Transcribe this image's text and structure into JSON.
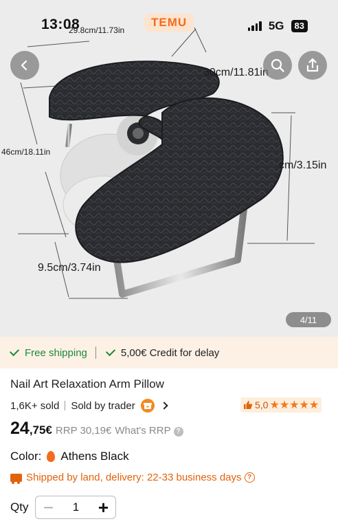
{
  "status_bar": {
    "time": "13:08",
    "network": "5G",
    "battery": "83"
  },
  "brand_badge": "TEMU",
  "gallery": {
    "counter": "4/11",
    "dimensions": {
      "top_width": "29.8cm/11.73in",
      "depth": "30cm/11.81in",
      "height": "46cm/18.11in",
      "thickness": "cm/3.15in",
      "base": "9.5cm/3.74in"
    }
  },
  "shipping_strip": {
    "free_shipping": "Free shipping",
    "credit": "5,00€ Credit for delay"
  },
  "product": {
    "title": "Nail Art Relaxation Arm Pillow",
    "sold": "1,6K+ sold",
    "seller": "Sold by trader",
    "rating": "5,0",
    "stars": "★★★★★",
    "price_main": "24",
    "price_cents": ",75€",
    "rrp": "RRP 30,19€",
    "whats_rrp": "What's RRP",
    "color_label": "Color:",
    "color_value": "Athens Black",
    "delivery": "Shipped by land, delivery: 22-33 business days",
    "qty_label": "Qty",
    "qty_value": "1"
  },
  "icons": {
    "back": "chevron-left-icon",
    "search": "search-icon",
    "share": "share-icon",
    "check": "check-icon",
    "store": "store-icon",
    "thumb": "thumbs-up-icon",
    "flame": "flame-icon",
    "truck": "truck-icon",
    "help": "question-icon"
  },
  "colors": {
    "accent": "#f26c1c",
    "green": "#1d8a3a",
    "strip_bg": "#fdf1e6"
  }
}
